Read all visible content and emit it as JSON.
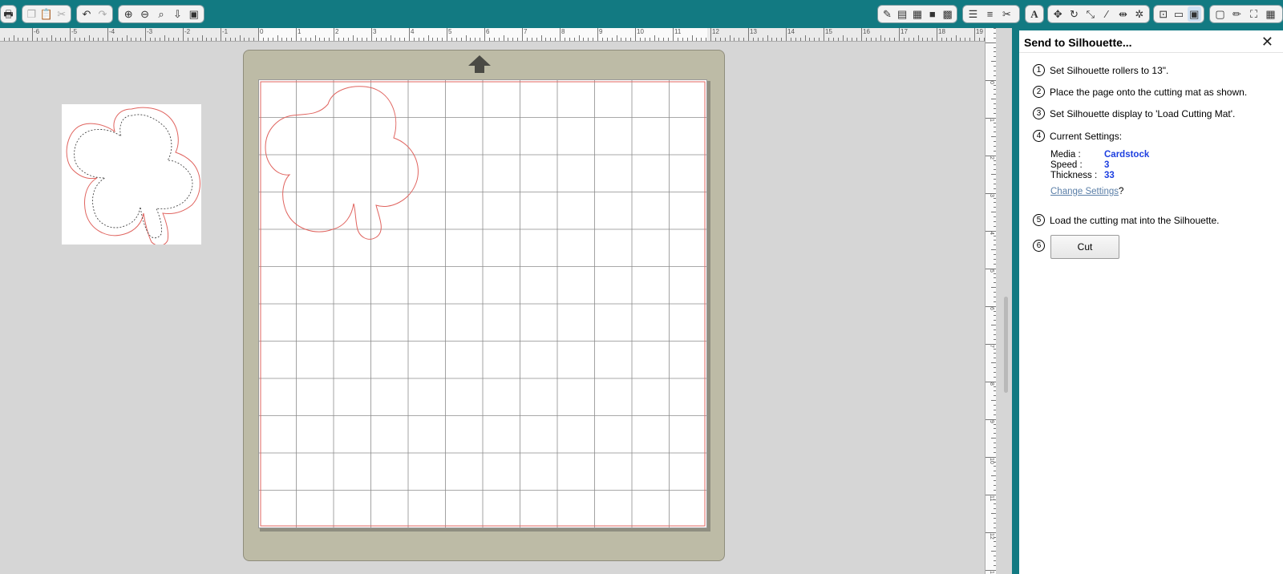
{
  "toolbar": {
    "left_group1": [
      "print-icon"
    ],
    "left_group2": [
      "copy-icon",
      "paste-icon",
      "scissors-icon"
    ],
    "left_group3": [
      "undo-icon",
      "redo-icon"
    ],
    "left_group4": [
      "zoom-in-icon",
      "zoom-out-icon",
      "zoom-select-icon",
      "pan-icon",
      "fit-page-icon"
    ]
  },
  "ruler": {
    "h_labels": [
      "-6",
      "-5",
      "-4",
      "-3",
      "-2",
      "-1",
      "0",
      "1",
      "2",
      "3",
      "4",
      "5",
      "6",
      "7",
      "8",
      "9",
      "10",
      "11",
      "12",
      "13",
      "14",
      "15",
      "16",
      "17",
      "18",
      "19"
    ],
    "v_labels": [
      "0",
      "1",
      "2",
      "3",
      "4",
      "5",
      "6",
      "7",
      "8",
      "9",
      "10",
      "11",
      "12",
      "13"
    ]
  },
  "panel": {
    "title": "Send to Silhouette...",
    "close": "✕",
    "steps": [
      {
        "num": "1",
        "text": "Set Silhouette rollers to 13\"."
      },
      {
        "num": "2",
        "text": "Place the page onto the cutting mat as shown."
      },
      {
        "num": "3",
        "text": "Set Silhouette display to 'Load Cutting Mat'."
      },
      {
        "num": "4",
        "text": "Current Settings:"
      },
      {
        "num": "5",
        "text": "Load the cutting mat into the Silhouette."
      },
      {
        "num": "6",
        "text": ""
      }
    ],
    "settings": [
      {
        "label": "Media :",
        "value": "Cardstock"
      },
      {
        "label": "Speed :",
        "value": "3"
      },
      {
        "label": "Thickness :",
        "value": "33"
      }
    ],
    "change_settings_link": "Change Settings",
    "change_settings_suffix": "?",
    "cut_button": "Cut"
  },
  "colors": {
    "toolbar_bg": "#127a82",
    "mat_bg": "#bdbba6",
    "cut_line": "#e0645f",
    "setting_value": "#1d3fe0"
  }
}
